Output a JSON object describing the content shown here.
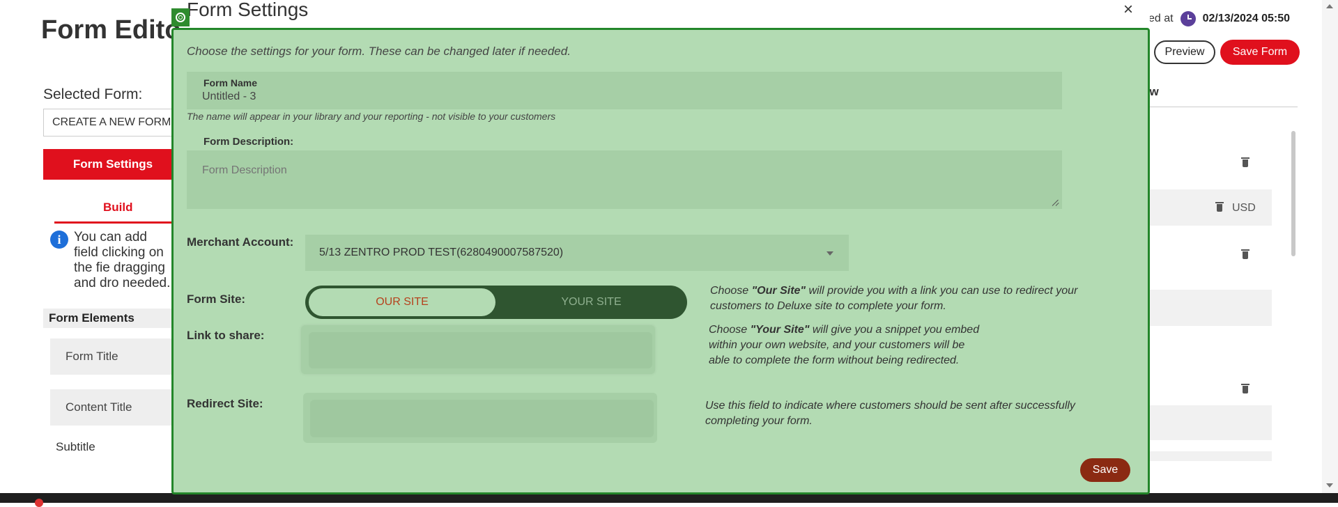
{
  "background": {
    "page_title": "Form Edito",
    "saved_prefix": "ved at",
    "saved_date": "02/13/2024 05:50",
    "preview_label": "Preview",
    "save_form_label": "Save Form",
    "right_tab_label": "ew",
    "currency": "USD",
    "selected_form_label": "Selected Form:",
    "selected_form_value": "CREATE A NEW FORM",
    "form_settings_label": "Form Settings",
    "build_tab_label": "Build",
    "info_text": "You can add field clicking on the fie dragging and dro needed.",
    "form_elements_header": "Form Elements",
    "elements": [
      "Form Title",
      "Content Title"
    ],
    "subtitle_item": "Subtitle"
  },
  "modal": {
    "title": "Form Settings",
    "close_label": "×",
    "intro": "Choose the settings for your form. These can be changed later if needed.",
    "form_name_label": "Form Name",
    "form_name_value": "Untitled - 3",
    "form_name_hint": "The name will appear in your library and your reporting - not visible to your customers",
    "description_label": "Form Description:",
    "description_placeholder": "Form Description",
    "merchant_label": "Merchant Account:",
    "merchant_value": "5/13 ZENTRO PROD TEST(6280490007587520)",
    "form_site_label": "Form Site:",
    "our_site": "OUR SITE",
    "your_site": "YOUR SITE",
    "link_label": "Link to share:",
    "redirect_label": "Redirect Site:",
    "help_our_site": {
      "pre": "Choose ",
      "bold": "\"Our Site\"",
      "post": " will provide you with a link you can use to redirect your customers to Deluxe site to complete your form."
    },
    "help_your_site": {
      "pre": "Choose ",
      "bold": "\"Your Site\"",
      "post": " will give you a snippet you embed within your own website, and your customers will be able to complete the form without being redirected."
    },
    "help_redirect": "Use this field to indicate where customers should be sent after successfully completing your form.",
    "save_label": "Save"
  },
  "colors": {
    "modal_bg": "#b3dbb3",
    "modal_border": "#23862a",
    "accent_red": "#e0101d",
    "save_brown": "#8b2a12",
    "toggle_dark": "#2f5530"
  }
}
